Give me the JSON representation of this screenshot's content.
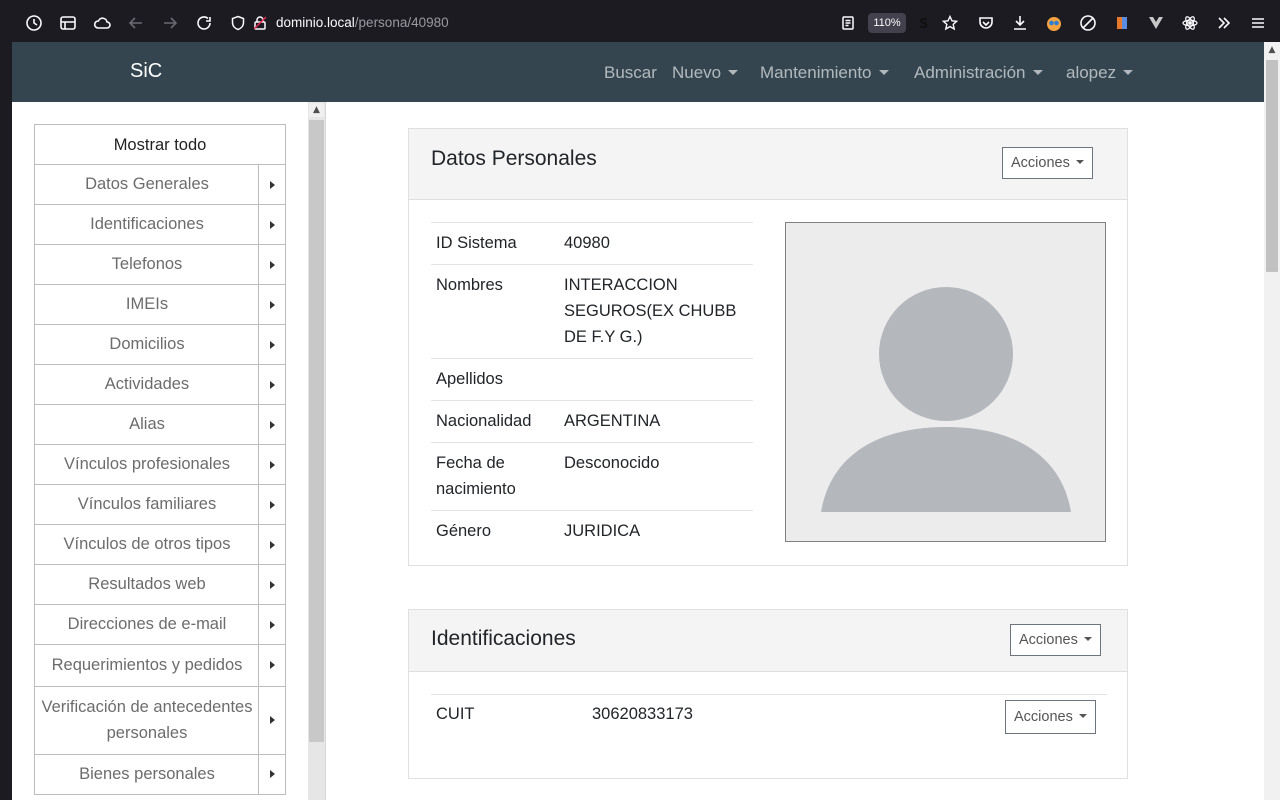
{
  "browser": {
    "url_host": "dominio.local",
    "url_path": "/persona/40980",
    "zoom": "110%"
  },
  "navbar": {
    "brand": "SiC",
    "items": [
      {
        "label": "Buscar",
        "dropdown": false
      },
      {
        "label": "Nuevo",
        "dropdown": true
      },
      {
        "label": "Mantenimiento",
        "dropdown": true
      },
      {
        "label": "Administración",
        "dropdown": true
      },
      {
        "label": "alopez",
        "dropdown": true
      }
    ]
  },
  "sidebar": {
    "show_all": "Mostrar todo",
    "items": [
      {
        "label": "Datos Generales"
      },
      {
        "label": "Identificaciones"
      },
      {
        "label": "Telefonos"
      },
      {
        "label": "IMEIs"
      },
      {
        "label": "Domicilios"
      },
      {
        "label": "Actividades"
      },
      {
        "label": "Alias"
      },
      {
        "label": "Vínculos profesionales"
      },
      {
        "label": "Vínculos familiares"
      },
      {
        "label": "Vínculos de otros tipos"
      },
      {
        "label": "Resultados web"
      },
      {
        "label": "Direcciones de e-mail"
      },
      {
        "label": "Requerimientos y pedidos"
      },
      {
        "label": "Verificación de antecedentes personales"
      },
      {
        "label": "Bienes personales"
      }
    ]
  },
  "datos_personales": {
    "title": "Datos Personales",
    "actions_label": "Acciones",
    "rows": [
      {
        "key": "ID Sistema",
        "value": "40980"
      },
      {
        "key": "Nombres",
        "value": "INTERACCION SEGUROS(EX CHUBB DE F.Y G.)"
      },
      {
        "key": "Apellidos",
        "value": ""
      },
      {
        "key": "Nacionalidad",
        "value": "ARGENTINA"
      },
      {
        "key": "Fecha de nacimiento",
        "value": "Desconocido"
      },
      {
        "key": "Género",
        "value": "JURIDICA"
      }
    ]
  },
  "identificaciones": {
    "title": "Identificaciones",
    "actions_label": "Acciones",
    "rows": [
      {
        "key": "CUIT",
        "value": "30620833173",
        "actions_label": "Acciones"
      }
    ]
  },
  "colors": {
    "navbar": "#34454f",
    "browser_chrome": "#1c1b22"
  }
}
